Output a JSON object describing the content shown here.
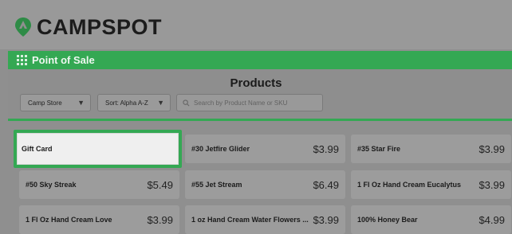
{
  "brand": {
    "name": "CAMPSPOT",
    "accent": "#34a853"
  },
  "header": {
    "title": "Point of Sale",
    "icon": "grid-icon"
  },
  "products": {
    "title": "Products",
    "filters": {
      "store_select": "Camp Store",
      "sort_select": "Sort: Alpha A-Z",
      "search_placeholder": "Search by Product Name or SKU"
    },
    "items": [
      {
        "name": "Gift Card",
        "price": "",
        "highlighted": true
      },
      {
        "name": "#30 Jetfire Glider",
        "price": "$3.99"
      },
      {
        "name": "#35 Star Fire",
        "price": "$3.99"
      },
      {
        "name": "#50 Sky Streak",
        "price": "$5.49"
      },
      {
        "name": "#55 Jet Stream",
        "price": "$6.49"
      },
      {
        "name": "1 Fl Oz Hand Cream Eucalytus",
        "price": "$3.99"
      },
      {
        "name": "1 Fl Oz Hand Cream Love",
        "price": "$3.99"
      },
      {
        "name": "1 oz Hand Cream Water Flowers ...",
        "price": "$3.99"
      },
      {
        "name": "100% Honey Bear",
        "price": "$4.99"
      }
    ]
  }
}
